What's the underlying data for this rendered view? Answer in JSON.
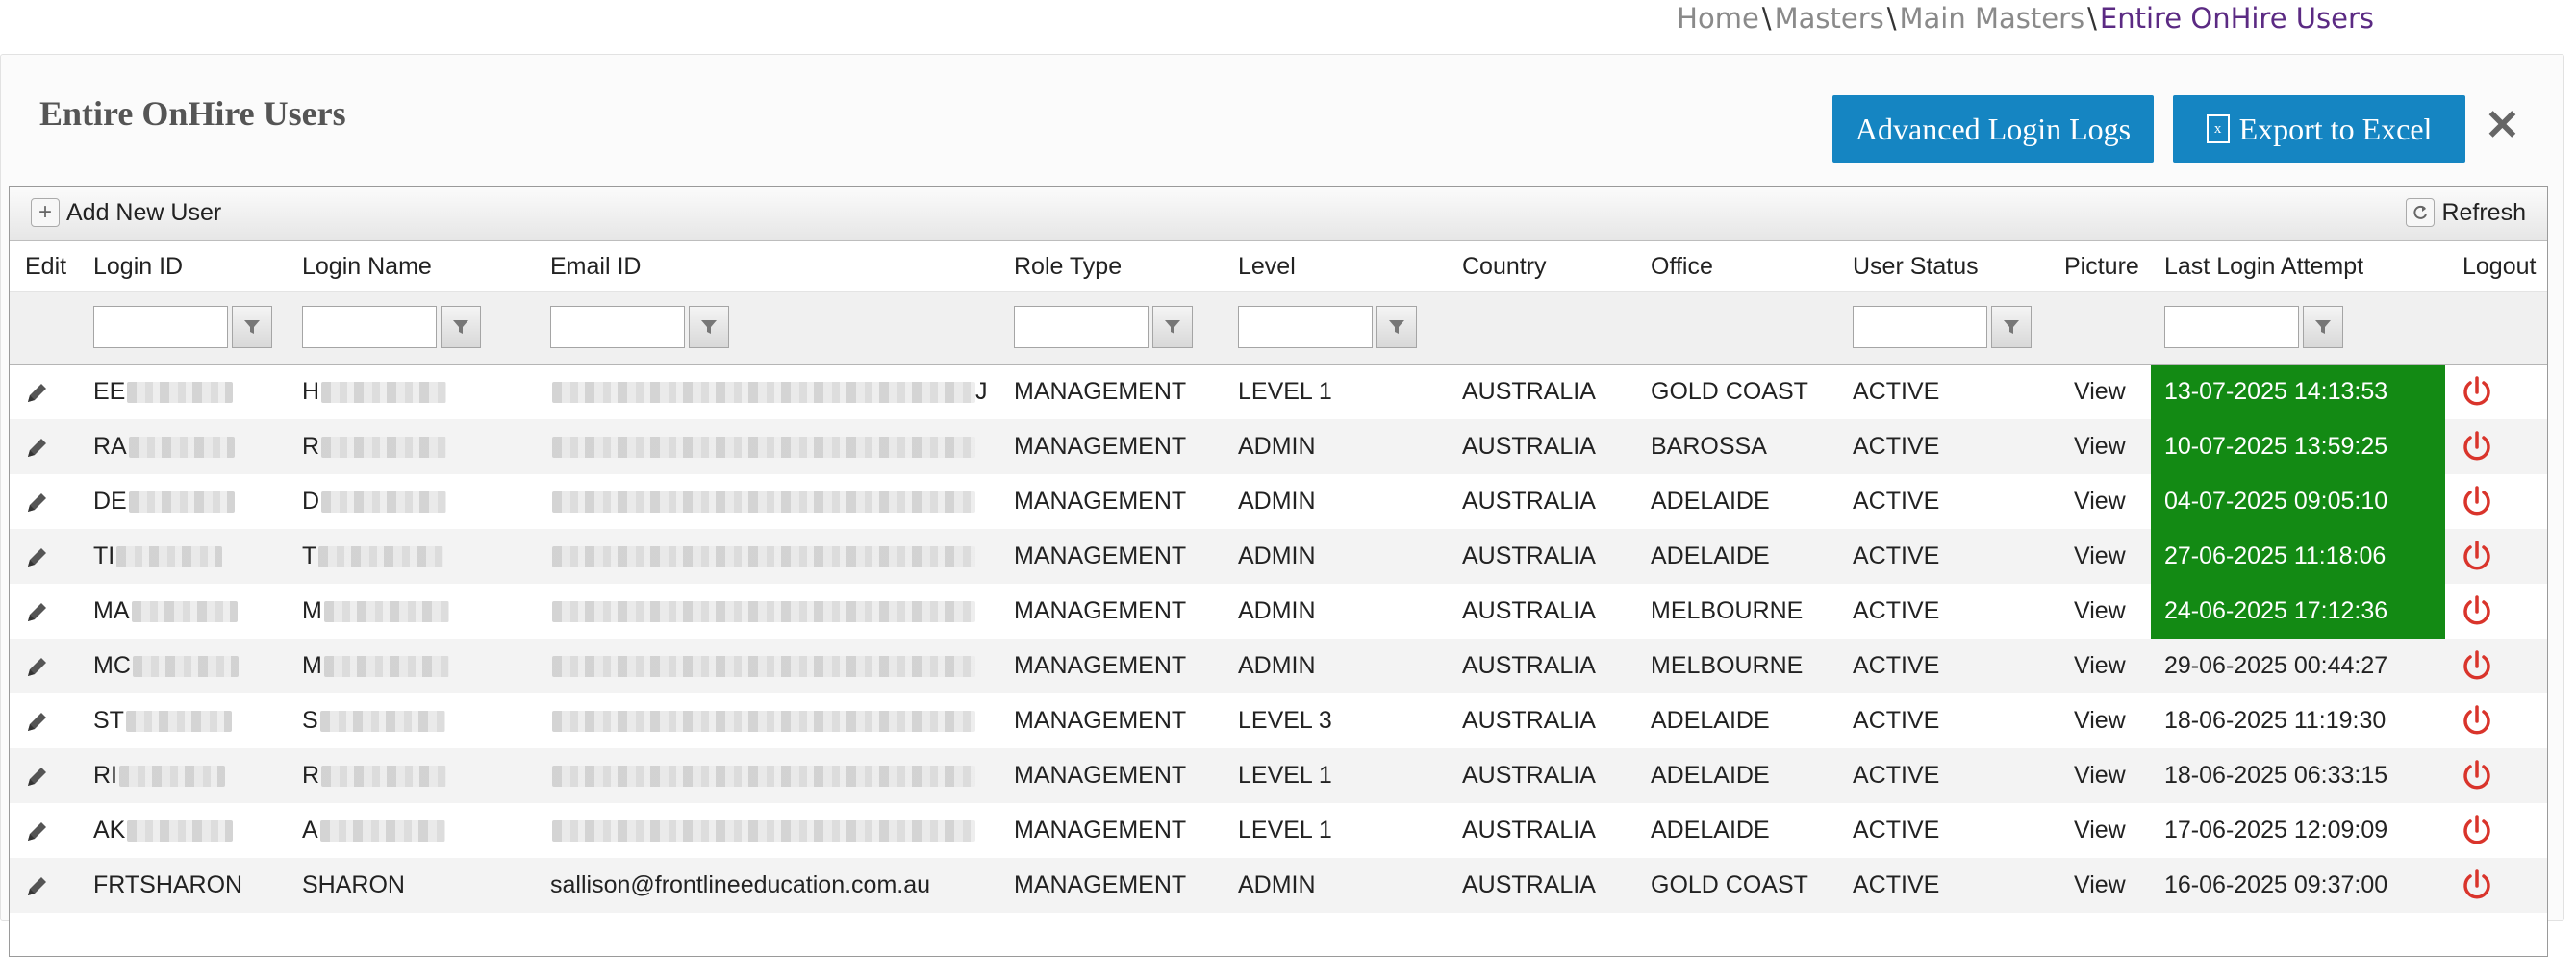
{
  "breadcrumb": {
    "items": [
      "Home",
      "Masters",
      "Main Masters"
    ],
    "current": "Entire OnHire Users",
    "separator": "\\"
  },
  "page": {
    "title": "Entire OnHire Users"
  },
  "actions": {
    "login_logs": "Advanced Login Logs",
    "export": "Export to Excel",
    "close": "✕"
  },
  "toolbar": {
    "add_user": "Add New User",
    "refresh": "Refresh"
  },
  "columns": [
    "Edit",
    "Login ID",
    "Login Name",
    "Email ID",
    "Role Type",
    "Level",
    "Country",
    "Office",
    "User Status",
    "Picture",
    "Last Login Attempt",
    "Logout"
  ],
  "colors": {
    "accent": "#1585c2",
    "recent_login": "#138a14",
    "logout": "#d9342b",
    "breadcrumb_current": "#5b2a83"
  },
  "rows": [
    {
      "login_id": "EE",
      "login_name": "H",
      "email": "",
      "email_tail": "J",
      "role": "MANAGEMENT",
      "level": "LEVEL 1",
      "country": "AUSTRALIA",
      "office": "GOLD COAST",
      "status": "ACTIVE",
      "picture": "View",
      "last_login": "13-07-2025 14:13:53",
      "recent": true
    },
    {
      "login_id": "RA",
      "login_name": "R",
      "email": "",
      "email_tail": "",
      "role": "MANAGEMENT",
      "level": "ADMIN",
      "country": "AUSTRALIA",
      "office": "BAROSSA",
      "status": "ACTIVE",
      "picture": "View",
      "last_login": "10-07-2025 13:59:25",
      "recent": true
    },
    {
      "login_id": "DE",
      "login_name": "D",
      "email": "",
      "email_tail": "",
      "role": "MANAGEMENT",
      "level": "ADMIN",
      "country": "AUSTRALIA",
      "office": "ADELAIDE",
      "status": "ACTIVE",
      "picture": "View",
      "last_login": "04-07-2025 09:05:10",
      "recent": true
    },
    {
      "login_id": "TI",
      "login_name": "T",
      "email": "",
      "email_tail": "",
      "role": "MANAGEMENT",
      "level": "ADMIN",
      "country": "AUSTRALIA",
      "office": "ADELAIDE",
      "status": "ACTIVE",
      "picture": "View",
      "last_login": "27-06-2025 11:18:06",
      "recent": true
    },
    {
      "login_id": "MA",
      "login_name": "M",
      "email": "",
      "email_tail": "",
      "role": "MANAGEMENT",
      "level": "ADMIN",
      "country": "AUSTRALIA",
      "office": "MELBOURNE",
      "status": "ACTIVE",
      "picture": "View",
      "last_login": "24-06-2025 17:12:36",
      "recent": true
    },
    {
      "login_id": "MC",
      "login_name": "M",
      "email": "",
      "email_tail": "",
      "role": "MANAGEMENT",
      "level": "ADMIN",
      "country": "AUSTRALIA",
      "office": "MELBOURNE",
      "status": "ACTIVE",
      "picture": "View",
      "last_login": "29-06-2025 00:44:27",
      "recent": false
    },
    {
      "login_id": "ST",
      "login_name": "S",
      "email": "",
      "email_tail": "",
      "role": "MANAGEMENT",
      "level": "LEVEL 3",
      "country": "AUSTRALIA",
      "office": "ADELAIDE",
      "status": "ACTIVE",
      "picture": "View",
      "last_login": "18-06-2025 11:19:30",
      "recent": false
    },
    {
      "login_id": "RI",
      "login_name": "R",
      "email": "",
      "email_tail": "",
      "role": "MANAGEMENT",
      "level": "LEVEL 1",
      "country": "AUSTRALIA",
      "office": "ADELAIDE",
      "status": "ACTIVE",
      "picture": "View",
      "last_login": "18-06-2025 06:33:15",
      "recent": false
    },
    {
      "login_id": "AK",
      "login_name": "A",
      "email": "",
      "email_tail": "",
      "role": "MANAGEMENT",
      "level": "LEVEL 1",
      "country": "AUSTRALIA",
      "office": "ADELAIDE",
      "status": "ACTIVE",
      "picture": "View",
      "last_login": "17-06-2025 12:09:09",
      "recent": false
    },
    {
      "login_id": "FRTSHARON",
      "login_name": "SHARON",
      "email": "sallison@frontlineeducation.com.au",
      "email_tail": "",
      "role": "MANAGEMENT",
      "level": "ADMIN",
      "country": "AUSTRALIA",
      "office": "GOLD COAST",
      "status": "ACTIVE",
      "picture": "View",
      "last_login": "16-06-2025 09:37:00",
      "recent": false
    }
  ]
}
